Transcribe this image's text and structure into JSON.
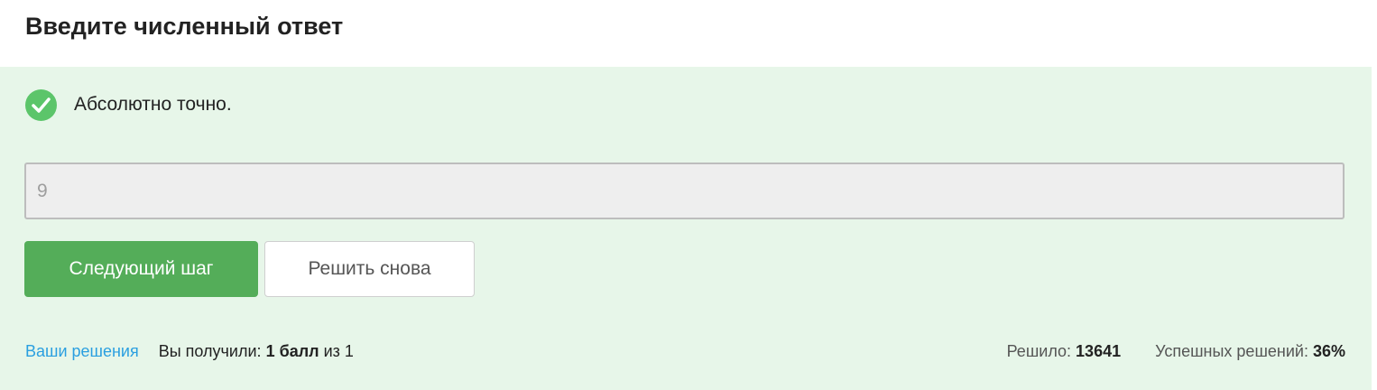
{
  "header": {
    "title": "Введите численный ответ"
  },
  "status": {
    "icon": "check-circle-icon",
    "text": "Абсолютно точно."
  },
  "answer": {
    "value": "9"
  },
  "buttons": {
    "next_label": "Следующий шаг",
    "retry_label": "Решить снова"
  },
  "footer": {
    "solutions_link": "Ваши решения",
    "received_prefix": "Вы получили:",
    "received_points": "1 балл",
    "received_suffix": "из 1",
    "solved_label": "Решило:",
    "solved_count": "13641",
    "success_label": "Успешных решений:",
    "success_rate": "36%"
  },
  "colors": {
    "panel_bg": "#e7f6e9",
    "success_green": "#5cc56a",
    "primary_button": "#54ad59",
    "link": "#2a9fe0"
  }
}
